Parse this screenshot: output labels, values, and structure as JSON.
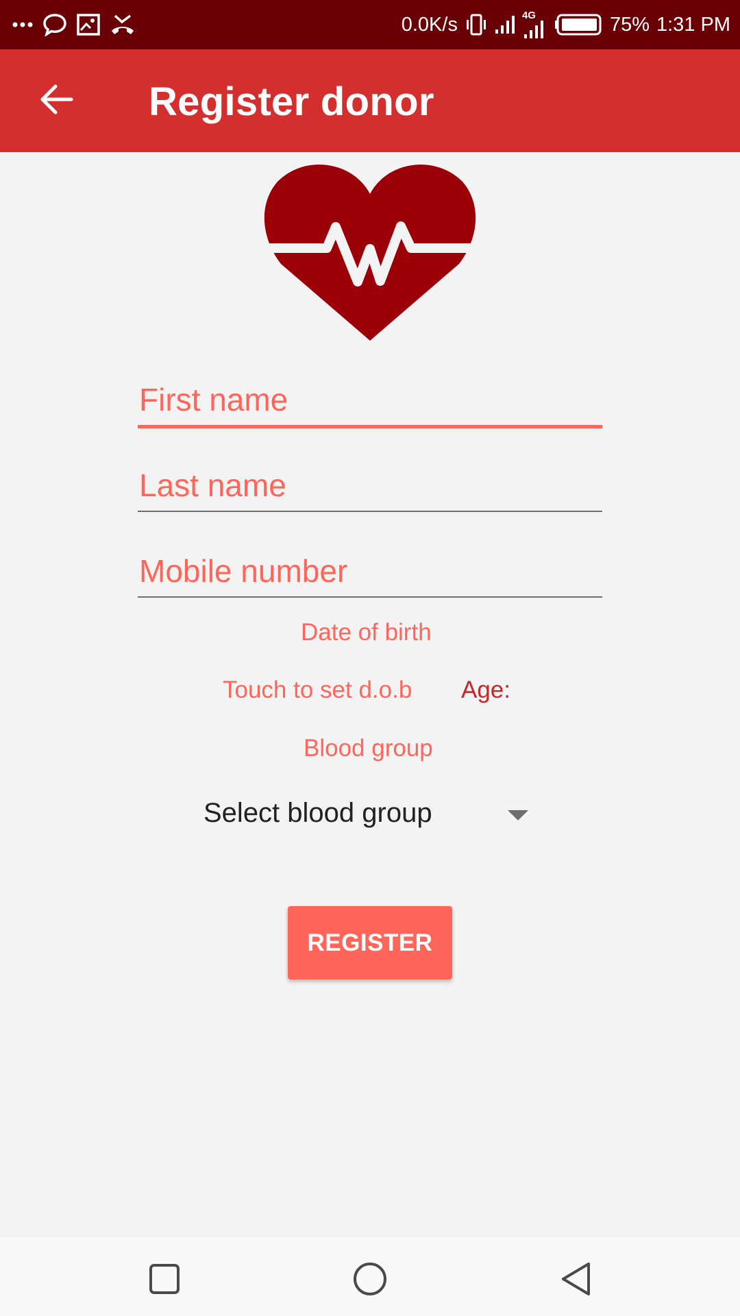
{
  "status_bar": {
    "net_speed": "0.0K/s",
    "network_type": "4G",
    "battery": "75%",
    "time": "1:31 PM",
    "icons": [
      "more-dots-icon",
      "chat-bubble-icon",
      "screenshot-icon",
      "missed-call-icon",
      "vibrate-icon",
      "signal-icon",
      "signal-4g-icon",
      "battery-icon"
    ]
  },
  "app_bar": {
    "title": "Register donor",
    "back_icon": "arrow-back-icon"
  },
  "logo": {
    "icon": "heart-pulse-icon",
    "color": "#9b0009"
  },
  "form": {
    "first_name": {
      "placeholder": "First name",
      "value": ""
    },
    "last_name": {
      "placeholder": "Last name",
      "value": ""
    },
    "mobile": {
      "placeholder": "Mobile number",
      "value": ""
    },
    "dob_label": "Date of birth",
    "dob_value": "Touch to set d.o.b",
    "age_label": "Age:",
    "blood_group_label": "Blood group",
    "blood_group_select": "Select blood group",
    "register_button": "REGISTER"
  },
  "nav_bar": {
    "icons": [
      "recents-square-icon",
      "home-circle-icon",
      "back-triangle-icon"
    ]
  },
  "colors": {
    "status_bar": "#690006",
    "app_bar": "#d32f2f",
    "accent": "#ff6659",
    "background": "#f3f3f3"
  }
}
